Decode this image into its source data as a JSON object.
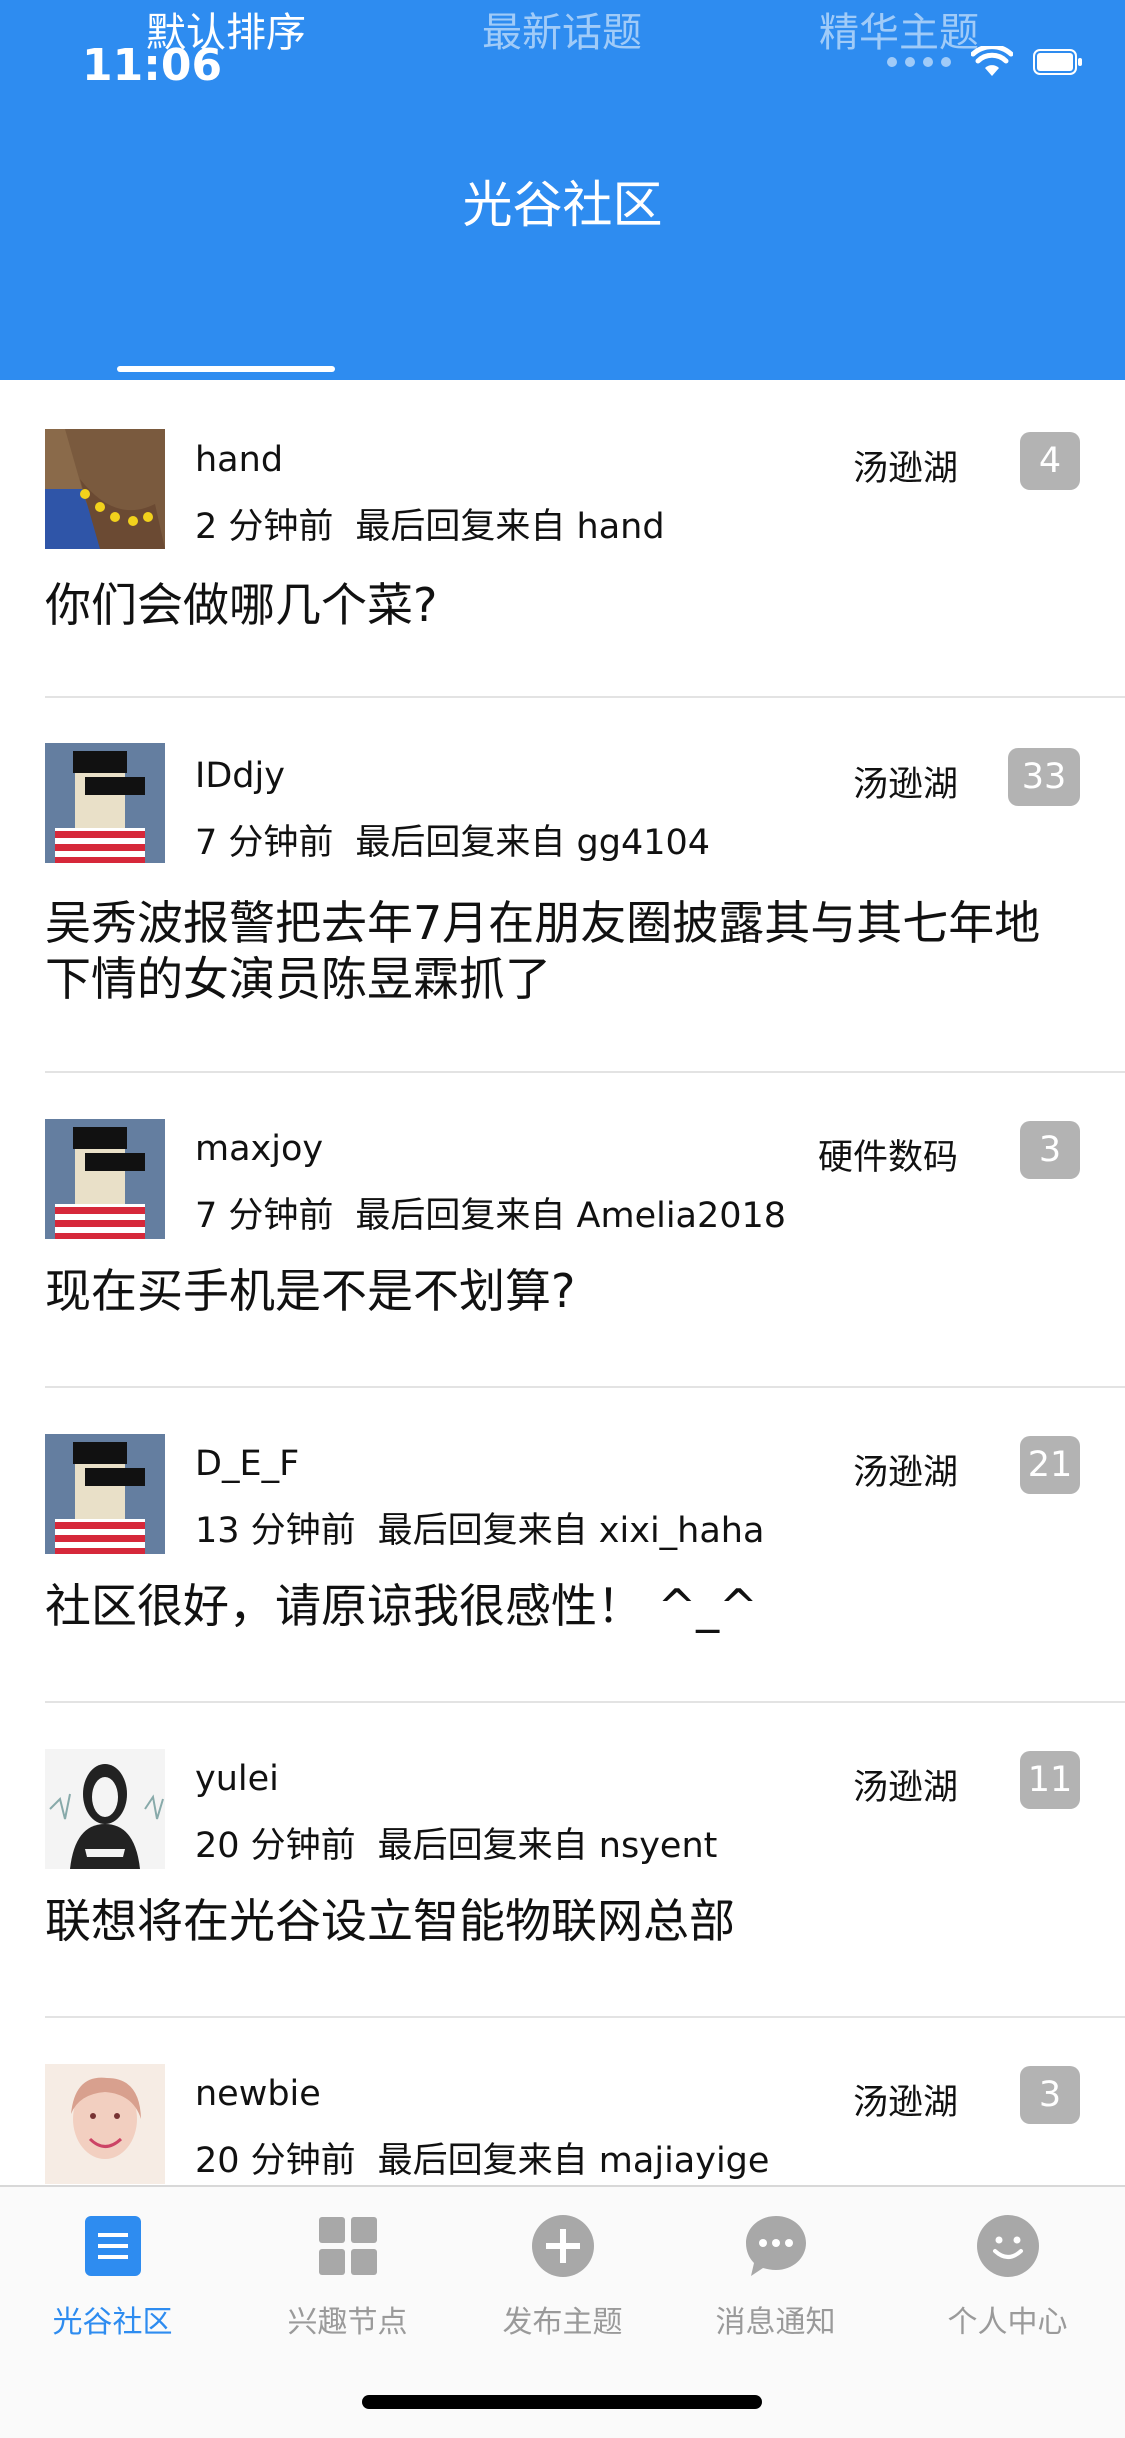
{
  "status_bar": {
    "time": "11:06"
  },
  "nav": {
    "title": "光谷社区"
  },
  "tabs": [
    {
      "label": "默认排序",
      "active": true
    },
    {
      "label": "最新话题",
      "active": false
    },
    {
      "label": "精华主题",
      "active": false
    }
  ],
  "posts": [
    {
      "username": "hand",
      "time": "2 分钟前",
      "last_reply": "最后回复来自 hand",
      "node": "汤逊湖",
      "count": "4",
      "title": "你们会做哪几个菜?"
    },
    {
      "username": "IDdjy",
      "time": "7 分钟前",
      "last_reply": "最后回复来自 gg4104",
      "node": "汤逊湖",
      "count": "33",
      "title": "吴秀波报警把去年7月在朋友圈披露其与其七年地下情的女演员陈昱霖抓了"
    },
    {
      "username": "maxjoy",
      "time": "7 分钟前",
      "last_reply": "最后回复来自 Amelia2018",
      "node": "硬件数码",
      "count": "3",
      "title": "现在买手机是不是不划算?"
    },
    {
      "username": "D_E_F",
      "time": "13 分钟前",
      "last_reply": "最后回复来自 xixi_haha",
      "node": "汤逊湖",
      "count": "21",
      "title": "社区很好，请原谅我很感性！ ^_^"
    },
    {
      "username": "yulei",
      "time": "20 分钟前",
      "last_reply": "最后回复来自 nsyent",
      "node": "汤逊湖",
      "count": "11",
      "title": "联想将在光谷设立智能物联网总部"
    },
    {
      "username": "newbie",
      "time": "20 分钟前",
      "last_reply": "最后回复来自 majiayige",
      "node": "汤逊湖",
      "count": "3",
      "title": ""
    }
  ],
  "tabbar": [
    {
      "label": "光谷社区",
      "icon": "list-doc-icon",
      "active": true
    },
    {
      "label": "兴趣节点",
      "icon": "grid-icon",
      "active": false
    },
    {
      "label": "发布主题",
      "icon": "plus-circle-icon",
      "active": false
    },
    {
      "label": "消息通知",
      "icon": "chat-bubble-icon",
      "active": false
    },
    {
      "label": "个人中心",
      "icon": "smiley-icon",
      "active": false
    }
  ],
  "colors": {
    "brand": "#2e8cf0",
    "badge": "#b3b3b3",
    "inactive": "#9a9a9a"
  }
}
